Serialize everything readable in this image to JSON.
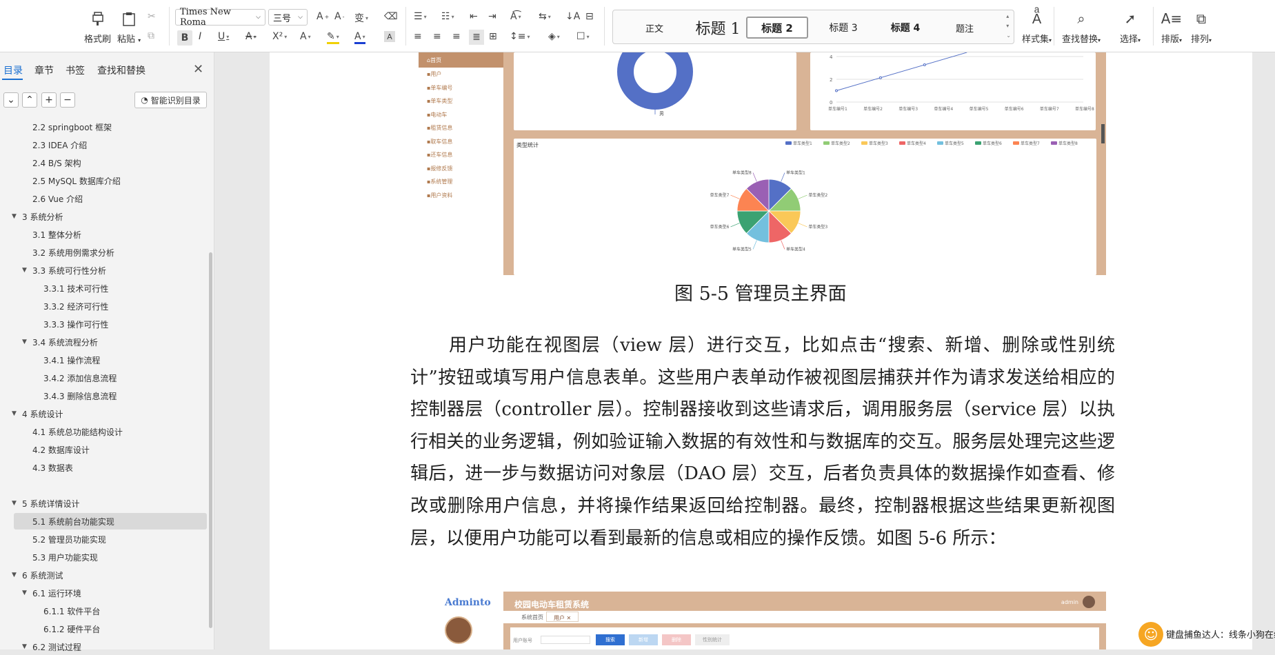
{
  "ribbon": {
    "format_painter": "格式刷",
    "paste": "粘贴",
    "font_name": "Times New Roma",
    "font_size": "三号",
    "styles": [
      "正文",
      "标题 1",
      "标题 2",
      "标题 3",
      "标题 4",
      "题注"
    ],
    "style_set": "样式集",
    "find_replace": "查找替换",
    "select": "选择",
    "layout": "排版",
    "arrange": "排列"
  },
  "sidebar": {
    "tabs": [
      "目录",
      "章节",
      "书签",
      "查找和替换"
    ],
    "active_tab": "目录",
    "smart_toc": "智能识别目录",
    "toc": [
      {
        "label": "2.2 springboot 框架",
        "level": 2
      },
      {
        "label": "2.3 IDEA 介绍",
        "level": 2
      },
      {
        "label": "2.4 B/S 架构",
        "level": 2
      },
      {
        "label": "2.5 MySQL 数据库介绍",
        "level": 2
      },
      {
        "label": "2.6 Vue 介绍",
        "level": 2
      },
      {
        "label": "3  系统分析",
        "level": 1
      },
      {
        "label": "3.1 整体分析",
        "level": 2
      },
      {
        "label": "3.2 系统用例需求分析",
        "level": 2
      },
      {
        "label": "3.3 系统可行性分析",
        "level": 2
      },
      {
        "label": "3.3.1 技术可行性",
        "level": 3
      },
      {
        "label": "3.3.2 经济可行性",
        "level": 3
      },
      {
        "label": "3.3.3 操作可行性",
        "level": 3
      },
      {
        "label": "3.4 系统流程分析",
        "level": 2
      },
      {
        "label": "3.4.1 操作流程",
        "level": 3
      },
      {
        "label": "3.4.2 添加信息流程",
        "level": 3
      },
      {
        "label": "3.4.3 删除信息流程",
        "level": 3
      },
      {
        "label": "4  系统设计",
        "level": 1
      },
      {
        "label": "4.1 系统总功能结构设计",
        "level": 2
      },
      {
        "label": "4.2 数据库设计",
        "level": 2
      },
      {
        "label": "4.3 数据表",
        "level": 2
      },
      {
        "label": "5  系统详情设计",
        "level": 1
      },
      {
        "label": "5.1 系统前台功能实现",
        "level": 2
      },
      {
        "label": "5.2 管理员功能实现",
        "level": 2
      },
      {
        "label": "5.3 用户功能实现",
        "level": 2
      },
      {
        "label": "6    系统测试",
        "level": 1
      },
      {
        "label": "6.1 运行环境",
        "level": 2
      },
      {
        "label": "6.1.1 软件平台",
        "level": 3
      },
      {
        "label": "6.1.2 硬件平台",
        "level": 3
      },
      {
        "label": "6.2 测试过程",
        "level": 2
      }
    ],
    "selected": "5.1 系统前台功能实现"
  },
  "figure1": {
    "menu": [
      "首页",
      "用户",
      "单车编号",
      "单车类型",
      "电动车",
      "租赁信息",
      "取车信息",
      "还车信息",
      "报修反馈",
      "系统管理",
      "用户资料"
    ],
    "chart_title": "类型统计",
    "pie_legend": [
      "单车类型1",
      "单车类型2",
      "单车类型3",
      "单车类型4",
      "单车类型5",
      "单车类型6",
      "单车类型7",
      "单车类型8"
    ],
    "pie_colors": [
      "#5470c6",
      "#91cc75",
      "#fac858",
      "#ee6666",
      "#73c0de",
      "#3ba272",
      "#fc8452",
      "#9a60b4"
    ],
    "line_x": [
      "单车编号1",
      "单车编号2",
      "单车编号3",
      "单车编号4",
      "单车编号5",
      "单车编号6",
      "单车编号7",
      "单车编号8"
    ],
    "line_y_ticks": [
      "4",
      "2",
      "0"
    ],
    "donut_label": "男"
  },
  "caption1": "图 5-5 管理员主界面",
  "paragraph": "用户功能在视图层（view 层）进行交互，比如点击“搜索、新增、删除或性别统计”按钮或填写用户信息表单。这些用户表单动作被视图层捕获并作为请求发送给相应的控制器层（controller 层）。控制器接收到这些请求后，调用服务层（service 层）以执行相关的业务逻辑，例如验证输入数据的有效性和与数据库的交互。服务层处理完这些逻辑后，进一步与数据访问对象层（DAO 层）交互，后者负责具体的数据操作如查看、修改或删除用户信息，并将操作结果返回给控制器。最终，控制器根据这些结果更新视图层，以便用户功能可以看到最新的信息或相应的操作反馈。如图 5-6 所示：",
  "figure2": {
    "logo": "Adminto",
    "app_title": "校园电动车租赁系统",
    "user": "admin",
    "tabs": [
      "系统首页",
      "用户"
    ],
    "buttons": [
      "搜索",
      "新增",
      "删除",
      "性别统计"
    ],
    "search_label": "用户账号"
  },
  "notification": "键盘捕鱼达人：线条小狗在线"
}
